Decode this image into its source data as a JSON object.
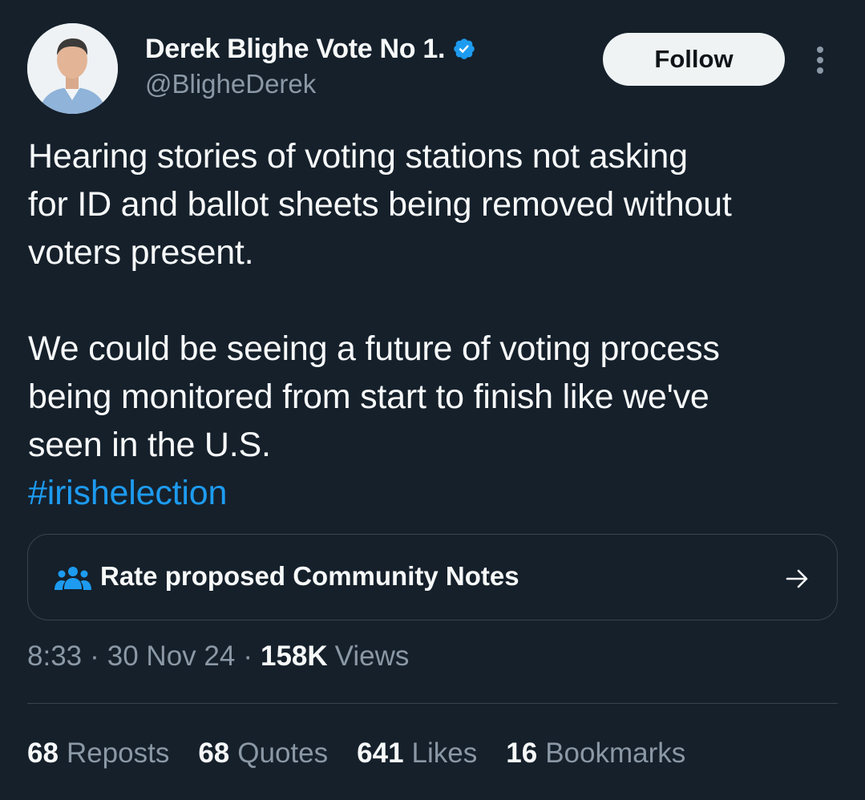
{
  "author": {
    "display_name": "Derek Blighe Vote No 1.",
    "handle": "@BligheDerek",
    "verified": true
  },
  "header": {
    "follow_label": "Follow"
  },
  "tweet": {
    "paragraph1_lines": [
      "Hearing stories of voting stations not asking",
      "for ID and ballot sheets being removed without",
      "voters present."
    ],
    "paragraph2_lines": [
      "We could be seeing a future of voting process",
      "being monitored from start to finish like we've",
      "seen in the U.S."
    ],
    "hashtag": "#irishelection"
  },
  "community_notes": {
    "label": "Rate proposed Community Notes"
  },
  "meta": {
    "time": "8:33",
    "date": "30 Nov 24",
    "separator": "·",
    "views_count": "158K",
    "views_label": "Views"
  },
  "stats": [
    {
      "count": "68",
      "label": "Reposts"
    },
    {
      "count": "68",
      "label": "Quotes"
    },
    {
      "count": "641",
      "label": "Likes"
    },
    {
      "count": "16",
      "label": "Bookmarks"
    }
  ],
  "colors": {
    "background": "#15202b",
    "text_primary": "#f7f9f9",
    "text_secondary": "#8b98a5",
    "accent": "#1d9bf0",
    "border": "#38444d"
  },
  "icons": {
    "verified": "verified-badge-icon",
    "more": "more-vertical-icon",
    "people": "people-icon",
    "arrow": "arrow-right-icon"
  }
}
